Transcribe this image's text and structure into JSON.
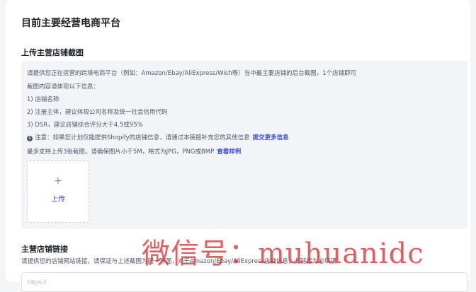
{
  "page": {
    "title": "目前主要经营电商平台"
  },
  "store_screenshot": {
    "title": "上传主营店铺截图",
    "instructions": [
      "请提供您正在运营的跨境电商平台（例如：Amazon/Ebay/AliExpress/Wish等）当中最主要店铺的后台截图，1个店铺即可",
      "截图内容请体现以下信息：",
      "1) 店铺名称",
      "2) 注册主体，建议体现公司名称及统一社会信用代码",
      "3) DSR，建议店铺综合评分大于4.5或95%"
    ],
    "note": {
      "icon": "info-icon",
      "text": "注意：如果您计划仅能提供Shopify的店铺信息，请通过本链接补充您的其他信息",
      "link": "提交更多信息"
    },
    "limit": {
      "text": "最多支持上传3张截图，请确保图片小于5M，格式为JPG，PNG或BMP",
      "link": "查看样例"
    },
    "upload": {
      "plus": "+",
      "label": "上传"
    }
  },
  "store_link": {
    "title": "主营店铺链接",
    "description": "请提供您的店铺网站链接，请保证与上述截图为同一界面，对于Amazon/Ebay/AliExpress店铺信息，此链接为必填项",
    "input_placeholder": "https://"
  },
  "watermark": "微信号：muhuanidc",
  "colors": {
    "accent": "#3b4ed8",
    "panel_bg": "#f3f4f8",
    "watermark": "#dc3c3c"
  }
}
